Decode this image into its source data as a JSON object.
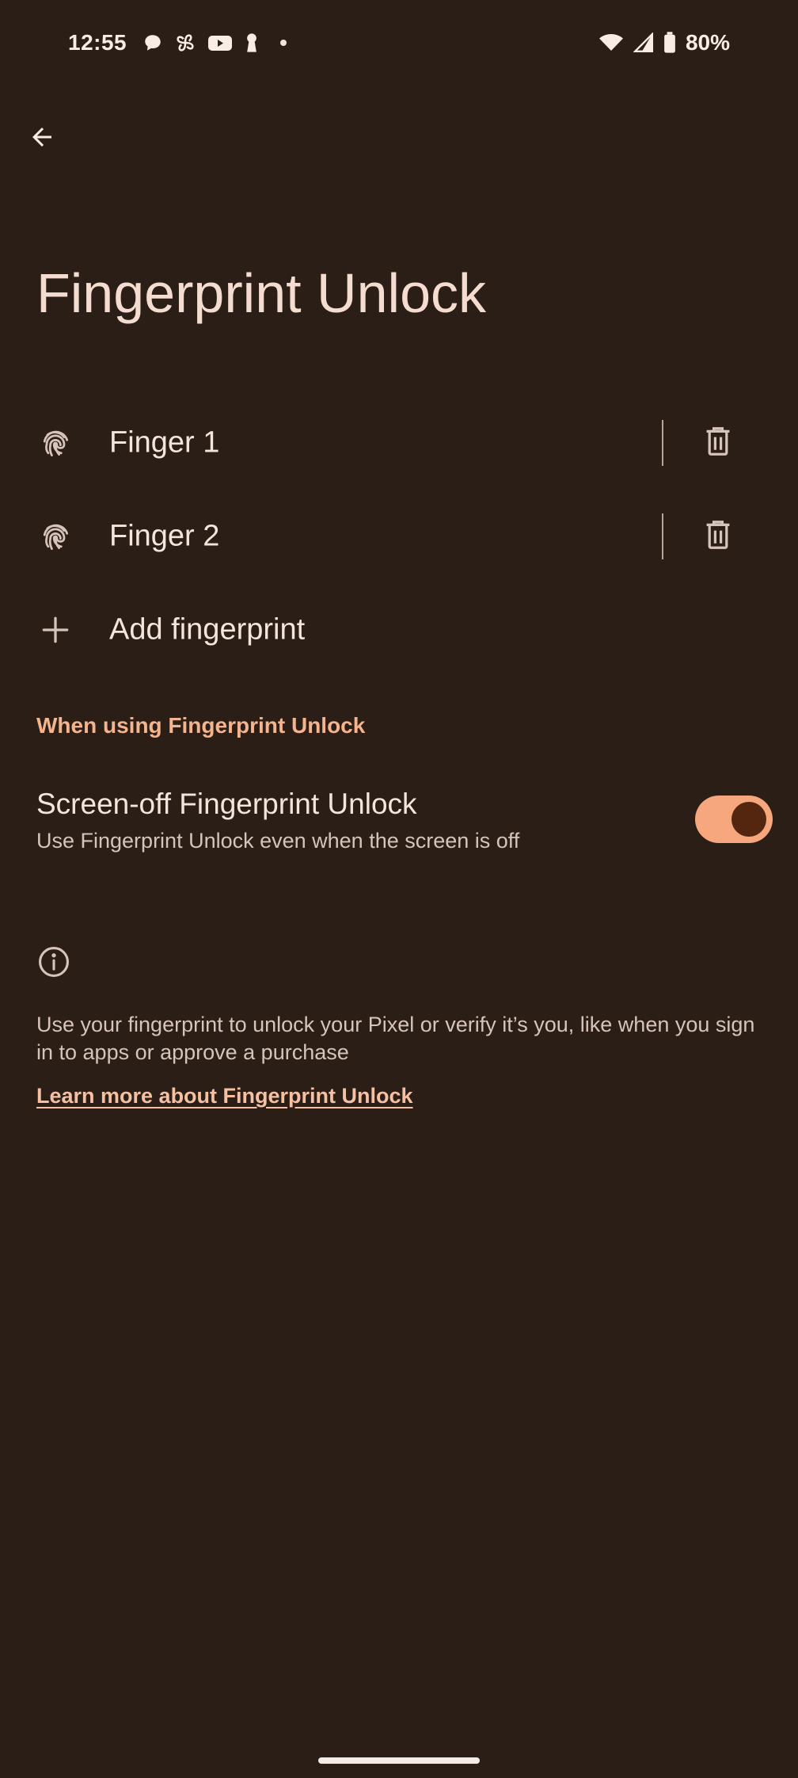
{
  "status_bar": {
    "time": "12:55",
    "battery": "80%",
    "left_icons": [
      "chat-bubble-icon",
      "pinwheel-icon",
      "youtube-icon",
      "keyhole-icon",
      "dot-icon"
    ],
    "right_icons": [
      "wifi-icon",
      "signal-icon",
      "battery-icon"
    ]
  },
  "app_bar": {
    "back_icon": "arrow-back-icon"
  },
  "page": {
    "title": "Fingerprint Unlock"
  },
  "fingerprints": [
    {
      "label": "Finger 1",
      "icon": "fingerprint-icon",
      "action_icon": "trash-icon"
    },
    {
      "label": "Finger 2",
      "icon": "fingerprint-icon",
      "action_icon": "trash-icon"
    }
  ],
  "add_item": {
    "label": "Add fingerprint",
    "icon": "plus-icon"
  },
  "section": {
    "header": "When using Fingerprint Unlock"
  },
  "screen_off_setting": {
    "title": "Screen-off Fingerprint Unlock",
    "subtitle": "Use Fingerprint Unlock even when the screen is off",
    "enabled": true
  },
  "footer": {
    "info_icon": "info-icon",
    "description": "Use your fingerprint to unlock your Pixel or verify it’s you, like when you sign in to apps or approve a purchase",
    "link": "Learn more about Fingerprint Unlock"
  },
  "colors": {
    "background": "#2a1e17",
    "accent": "#f6a77d",
    "section_header": "#f4b48e",
    "switch_thumb": "#54260f"
  }
}
